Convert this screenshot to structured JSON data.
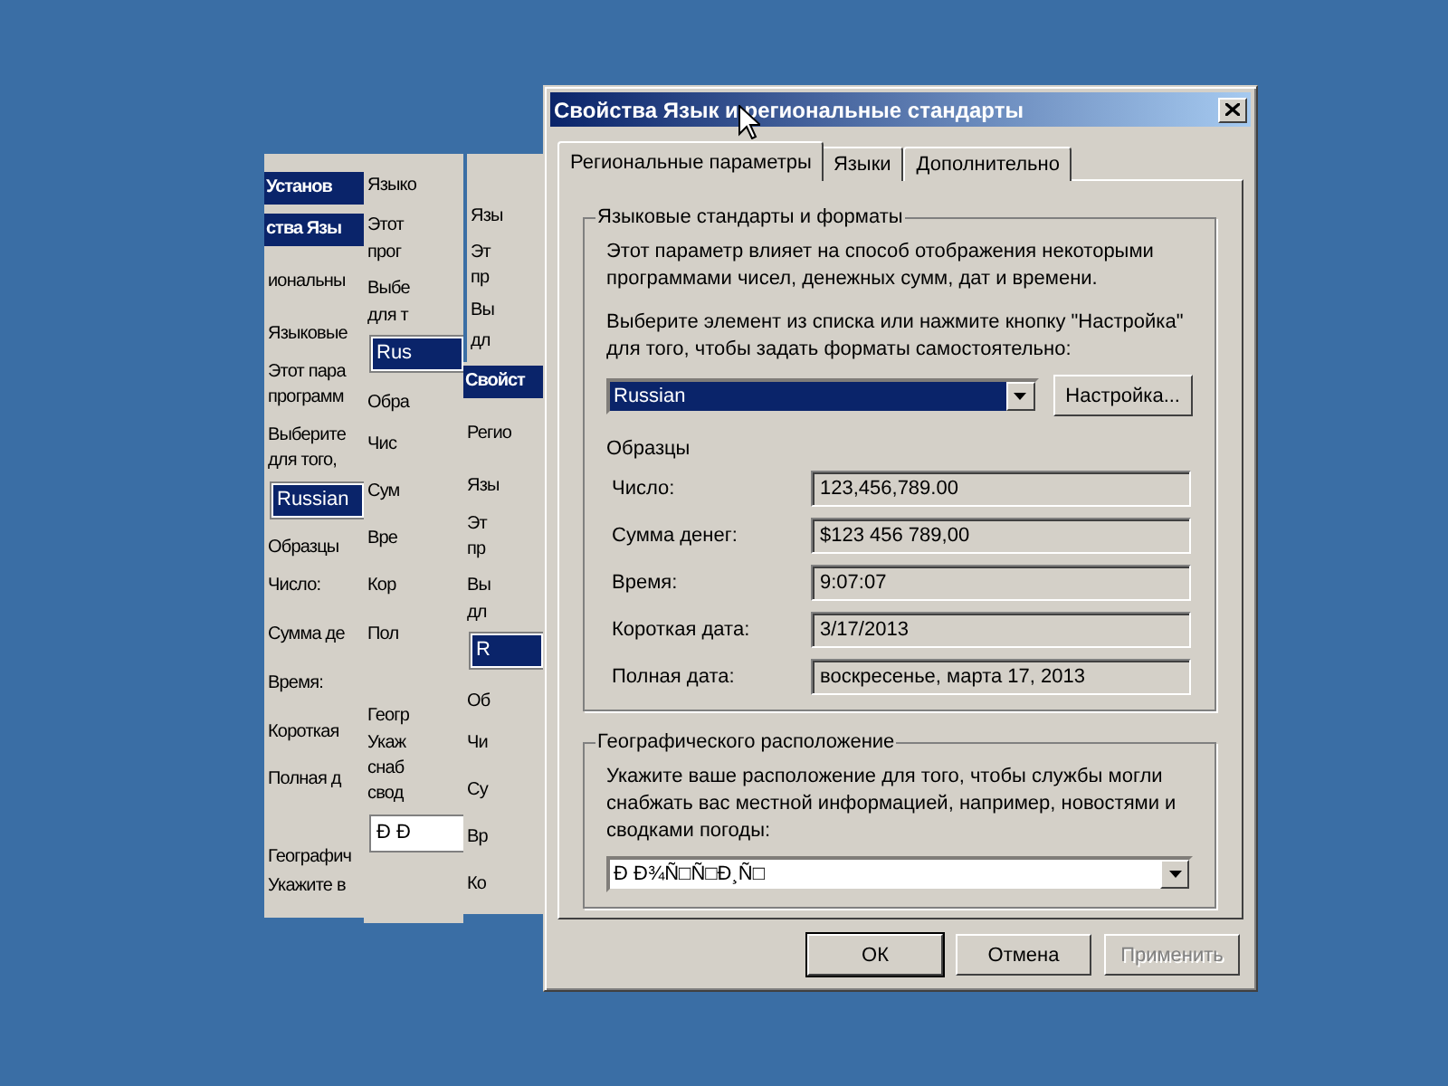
{
  "desktop": {
    "ghost_strips": [
      {
        "items": [
          {
            "kind": "title",
            "text": "Установ"
          },
          {
            "kind": "title",
            "text": "ства Язы"
          },
          {
            "kind": "text",
            "text": "иональны"
          },
          {
            "kind": "text",
            "text": "Языковые"
          },
          {
            "kind": "text",
            "text": "Этот пара"
          },
          {
            "kind": "text",
            "text": "программ"
          },
          {
            "kind": "text",
            "text": "Выберите"
          },
          {
            "kind": "text",
            "text": "для того,"
          },
          {
            "kind": "dropdown",
            "text": "Russian"
          },
          {
            "kind": "text",
            "text": "Образцы"
          },
          {
            "kind": "text",
            "text": "Число:"
          },
          {
            "kind": "text",
            "text": "Сумма де"
          },
          {
            "kind": "text",
            "text": "Время:"
          },
          {
            "kind": "text",
            "text": "Короткая"
          },
          {
            "kind": "text",
            "text": "Полная д"
          },
          {
            "kind": "text",
            "text": "Географич"
          },
          {
            "kind": "text",
            "text": "Укажите в"
          }
        ]
      },
      {
        "items": [
          {
            "kind": "text",
            "text": "Языко"
          },
          {
            "kind": "text",
            "text": "Этот"
          },
          {
            "kind": "text",
            "text": "прог"
          },
          {
            "kind": "text",
            "text": "Выбе"
          },
          {
            "kind": "text",
            "text": "для т"
          },
          {
            "kind": "dropdown",
            "text": "Rus"
          },
          {
            "kind": "text",
            "text": "Обра"
          },
          {
            "kind": "text",
            "text": "Чис"
          },
          {
            "kind": "text",
            "text": "Сум"
          },
          {
            "kind": "text",
            "text": "Вре"
          },
          {
            "kind": "text",
            "text": "Кор"
          },
          {
            "kind": "text",
            "text": "Пол"
          },
          {
            "kind": "text",
            "text": "Геогр"
          },
          {
            "kind": "text",
            "text": "Укаж"
          },
          {
            "kind": "text",
            "text": "снаб"
          },
          {
            "kind": "text",
            "text": "свод"
          },
          {
            "kind": "field",
            "text": "Ð Ð"
          }
        ]
      },
      {
        "items": [
          {
            "kind": "text",
            "text": "Язы"
          },
          {
            "kind": "text",
            "text": "Эт"
          },
          {
            "kind": "text",
            "text": "пр"
          },
          {
            "kind": "text",
            "text": "Вы"
          },
          {
            "kind": "text",
            "text": "дл"
          }
        ]
      },
      {
        "items": [
          {
            "kind": "title",
            "text": "Свойст"
          },
          {
            "kind": "text",
            "text": "Регио"
          },
          {
            "kind": "text",
            "text": "Язы"
          },
          {
            "kind": "text",
            "text": "Эт"
          },
          {
            "kind": "text",
            "text": "пр"
          },
          {
            "kind": "text",
            "text": "Вы"
          },
          {
            "kind": "text",
            "text": "дл"
          },
          {
            "kind": "dropdown",
            "text": "R"
          },
          {
            "kind": "text",
            "text": "Об"
          },
          {
            "kind": "text",
            "text": "Чи"
          },
          {
            "kind": "text",
            "text": "Су"
          },
          {
            "kind": "text",
            "text": "Вр"
          },
          {
            "kind": "text",
            "text": "Ко"
          }
        ]
      }
    ]
  },
  "window": {
    "title": "Свойства Язык и региональные стандарты",
    "tabs": [
      {
        "label": "Региональные параметры",
        "selected": true
      },
      {
        "label": "Языки",
        "selected": false
      },
      {
        "label": "Дополнительно",
        "selected": false
      }
    ],
    "formats_group": {
      "title": "Языковые стандарты и форматы",
      "description": "Этот параметр влияет на способ отображения некоторыми программами чисел, денежных сумм, дат и времени.",
      "instruction": "Выберите элемент из списка или нажмите кнопку \"Настройка\" для того, чтобы задать форматы самостоятельно:",
      "locale": {
        "value": "Russian",
        "selected": true
      },
      "customize_button": "Настройка...",
      "samples_title": "Образцы",
      "samples": [
        {
          "label": "Число:",
          "value": "123,456,789.00"
        },
        {
          "label": "Сумма денег:",
          "value": "$123 456 789,00"
        },
        {
          "label": "Время:",
          "value": "9:07:07"
        },
        {
          "label": "Короткая дата:",
          "value": "3/17/2013"
        },
        {
          "label": "Полная дата:",
          "value": "воскресенье, марта 17, 2013"
        }
      ]
    },
    "location_group": {
      "title": "Географического расположение",
      "description": "Укажите ваше расположение для того, чтобы службы могли снабжать вас местной информацией, например, новостями и сводками погоды:",
      "location": {
        "value": "Ð Ð¾Ñ□Ñ□Ð¸Ñ□"
      }
    },
    "buttons": [
      {
        "label": "ОК",
        "disabled": false
      },
      {
        "label": "Отмена",
        "disabled": false
      },
      {
        "label": "Применить",
        "disabled": true
      }
    ]
  }
}
